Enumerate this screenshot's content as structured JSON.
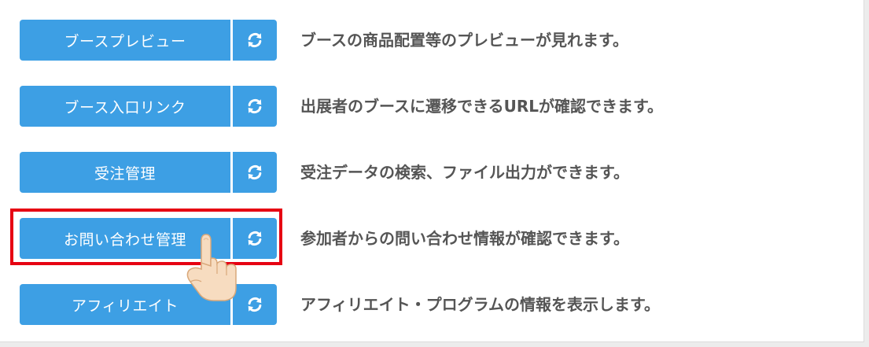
{
  "rows": [
    {
      "button_label": "ブースプレビュー",
      "refresh_icon": "refresh-icon",
      "description": "ブースの商品配置等のプレビューが見れます。"
    },
    {
      "button_label": "ブース入口リンク",
      "refresh_icon": "refresh-icon",
      "description": "出展者のブースに遷移できるURLが確認できます。"
    },
    {
      "button_label": "受注管理",
      "refresh_icon": "refresh-icon",
      "description": "受注データの検索、ファイル出力ができます。"
    },
    {
      "button_label": "お問い合わせ管理",
      "refresh_icon": "refresh-icon",
      "description": "参加者からの問い合わせ情報が確認できます。"
    },
    {
      "button_label": "アフィリエイト",
      "refresh_icon": "refresh-icon",
      "description": "アフィリエイト・プログラムの情報を表示します。"
    }
  ],
  "colors": {
    "button_blue": "#3d9fe4",
    "highlight_red": "#e60012",
    "description_text": "#555555"
  },
  "annotation": {
    "highlighted_row": 3,
    "pointer_icon": "hand-pointer-icon"
  }
}
